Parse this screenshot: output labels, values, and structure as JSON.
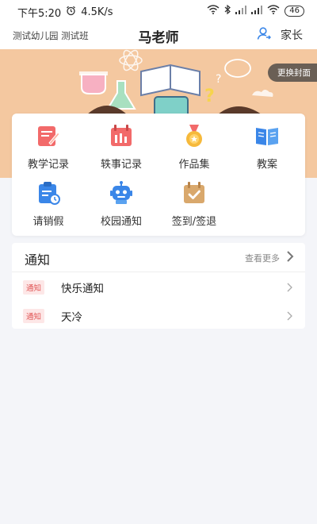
{
  "status_bar": {
    "time": "下午5:20",
    "speed": "4.5K/s",
    "battery": "46"
  },
  "header": {
    "school": "测试幼儿园 测试班",
    "title": "马老师",
    "role": "家长"
  },
  "banner": {
    "change_cover": "更换封面"
  },
  "menu": [
    {
      "label": "教学记录",
      "icon": "teaching-record-icon"
    },
    {
      "label": "轶事记录",
      "icon": "anecdote-record-icon"
    },
    {
      "label": "作品集",
      "icon": "portfolio-icon"
    },
    {
      "label": "教案",
      "icon": "lesson-plan-icon"
    },
    {
      "label": "请销假",
      "icon": "leave-request-icon"
    },
    {
      "label": "校园通知",
      "icon": "campus-notice-icon"
    },
    {
      "label": "签到/签退",
      "icon": "check-in-icon"
    }
  ],
  "notice": {
    "title": "通知",
    "see_more": "查看更多",
    "items": [
      {
        "tag": "通知",
        "text": "快乐通知"
      },
      {
        "tag": "通知",
        "text": "天冷"
      }
    ]
  },
  "colors": {
    "accent_blue": "#3a86e8",
    "tag_red": "#e05252",
    "banner_bg": "#f4c8a0"
  }
}
